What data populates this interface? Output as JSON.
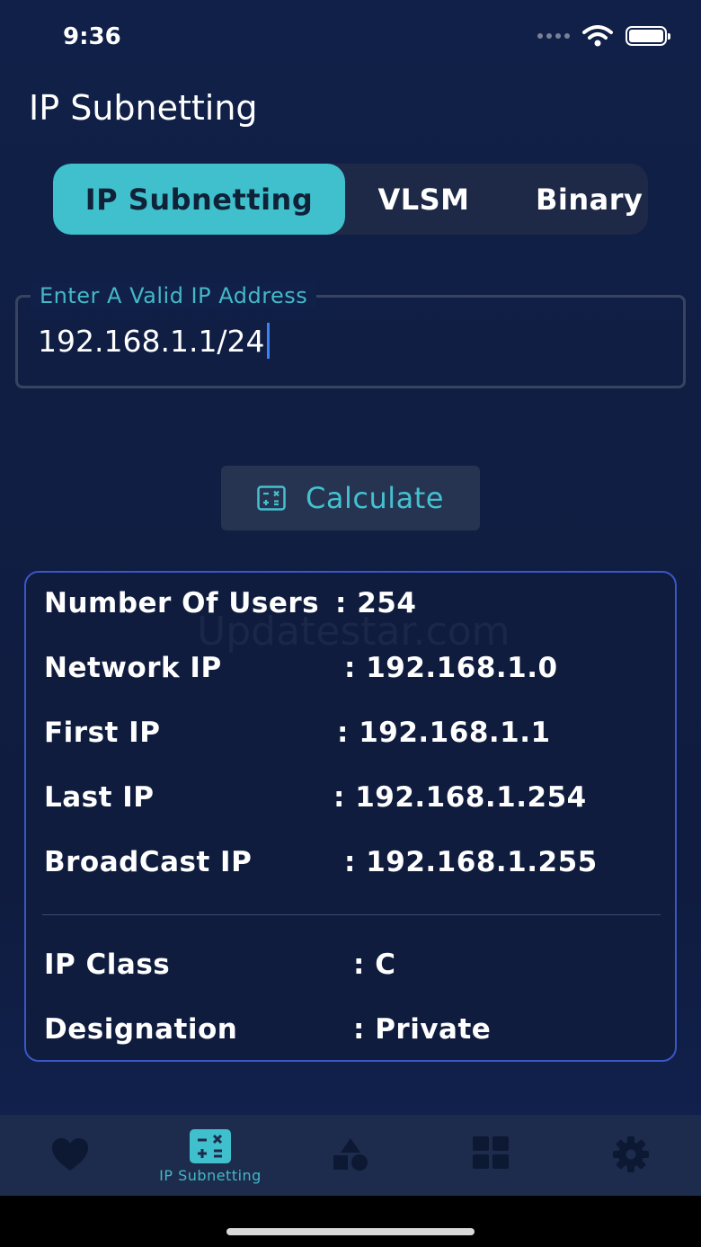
{
  "status_bar": {
    "time": "9:36"
  },
  "header": {
    "title": "IP Subnetting"
  },
  "segmented": {
    "tabs": [
      "IP Subnetting",
      "VLSM",
      "Binary"
    ],
    "active": 0
  },
  "input": {
    "label": "Enter A Valid IP Address",
    "value": "192.168.1.1/24"
  },
  "calculate": {
    "label": "Calculate",
    "icon": "calculator-icon"
  },
  "results": {
    "watermark": "Updatestar.com",
    "rows": [
      {
        "label": "Number Of Users",
        "value": ": 254"
      },
      {
        "label": "Network IP",
        "value": ": 192.168.1.0"
      },
      {
        "label": "First IP",
        "value": ": 192.168.1.1"
      },
      {
        "label": "Last IP",
        "value": ": 192.168.1.254"
      },
      {
        "label": "BroadCast IP",
        "value": ": 192.168.1.255"
      },
      {
        "label": "IP Class",
        "value": ": C"
      },
      {
        "label": "Designation",
        "value": ": Private"
      }
    ]
  },
  "tab_bar": {
    "items": [
      {
        "icon": "heart-icon",
        "label": ""
      },
      {
        "icon": "calculator-icon",
        "label": "IP Subnetting"
      },
      {
        "icon": "shapes-icon",
        "label": ""
      },
      {
        "icon": "grid-icon",
        "label": ""
      },
      {
        "icon": "gear-icon",
        "label": ""
      }
    ],
    "active": 1
  },
  "colors": {
    "accent": "#3fc0cc",
    "background": "#112048",
    "card_border": "#3a57c7"
  }
}
